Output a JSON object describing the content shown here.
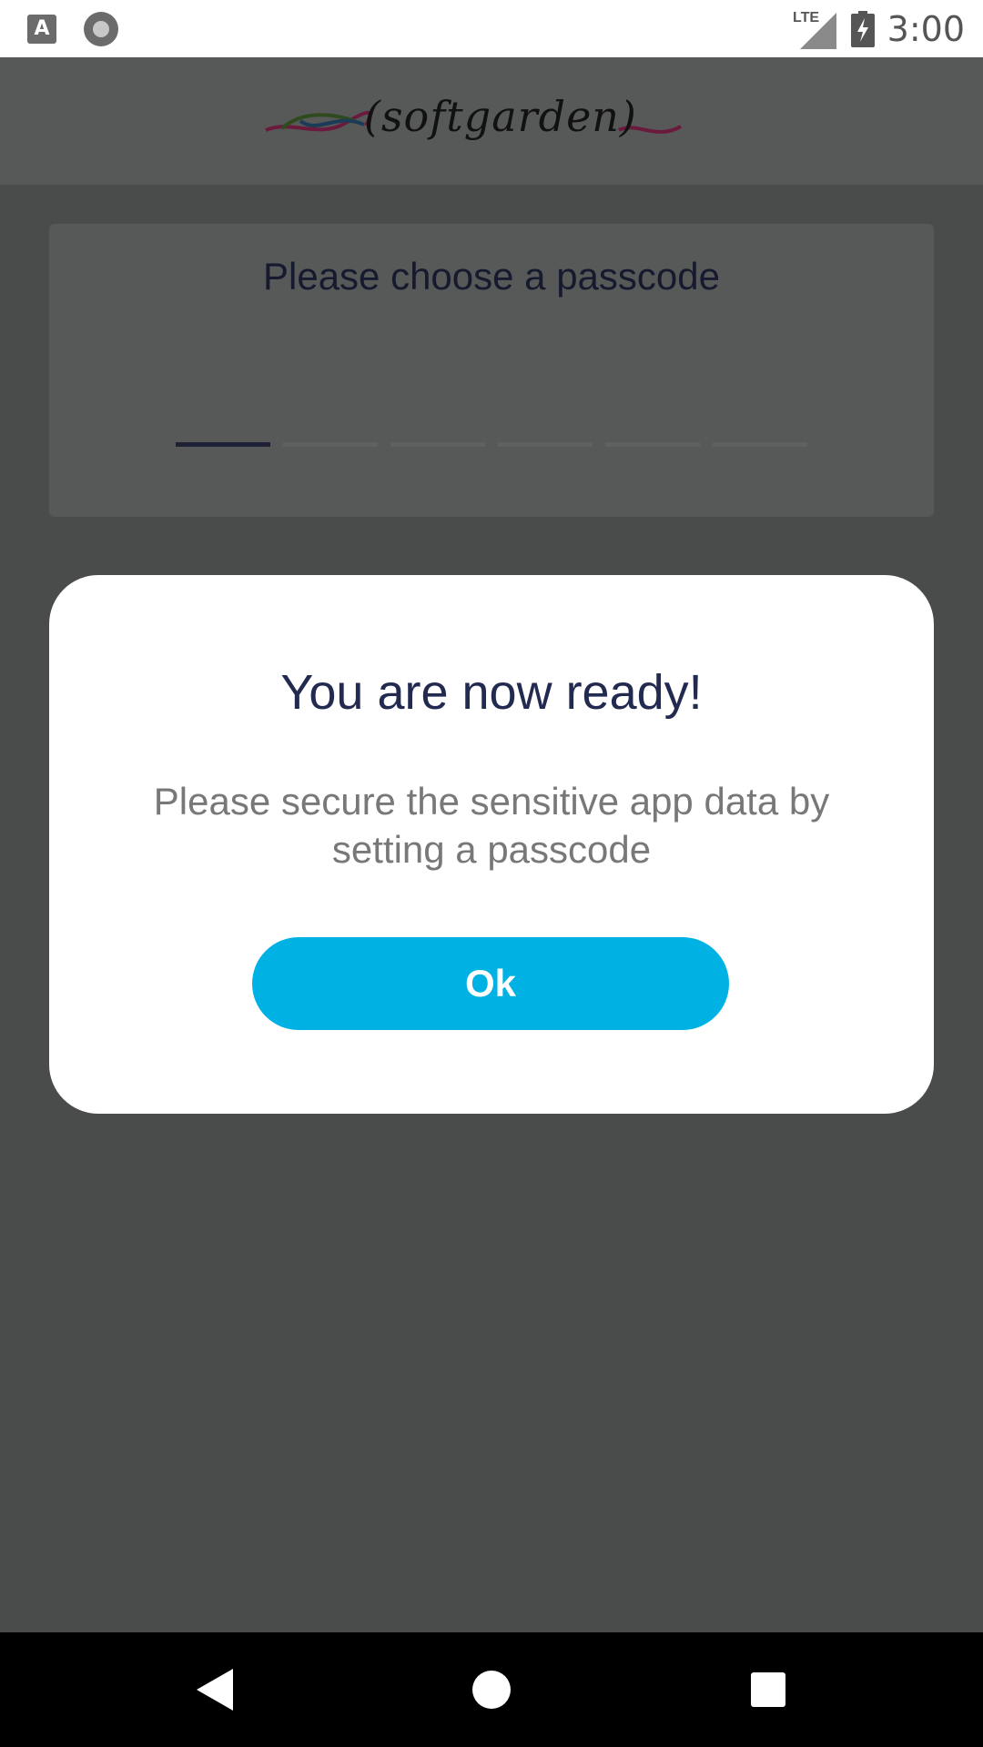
{
  "status_bar": {
    "left_icons": [
      "text-a-notification-icon",
      "circle-notification-icon"
    ],
    "notif_letter": "A",
    "network": "LTE",
    "time": "3:00"
  },
  "header": {
    "logo_text": "(softgarden)"
  },
  "passcode": {
    "title": "Please choose a passcode",
    "digits_total": 6,
    "digits_entered": 0
  },
  "dialog": {
    "title": "You are now ready!",
    "message": "Please secure the sensitive app data by setting a passcode",
    "ok_label": "Ok"
  },
  "nav": {
    "icons": [
      "back-icon",
      "home-icon",
      "recents-icon"
    ]
  },
  "colors": {
    "accent": "#00b2e4",
    "dialog_title": "#222a50",
    "scrim": "#4a4b4b"
  }
}
